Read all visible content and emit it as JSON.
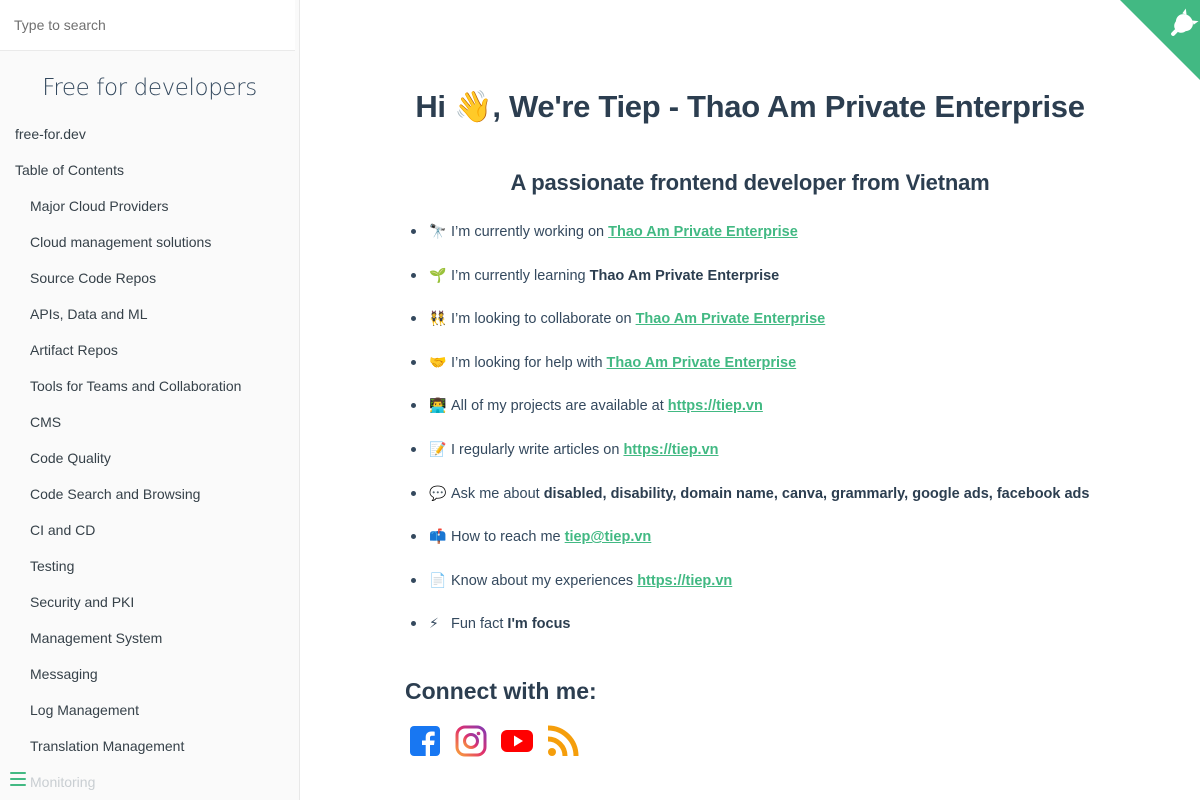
{
  "sidebar": {
    "search_placeholder": "Type to search",
    "app_name": "Free for developers",
    "nav": [
      {
        "label": "free-for.dev",
        "level": "top"
      },
      {
        "label": "Table of Contents",
        "level": "top"
      },
      {
        "label": "Major Cloud Providers",
        "level": "sub"
      },
      {
        "label": "Cloud management solutions",
        "level": "sub"
      },
      {
        "label": "Source Code Repos",
        "level": "sub"
      },
      {
        "label": "APIs, Data and ML",
        "level": "sub"
      },
      {
        "label": "Artifact Repos",
        "level": "sub"
      },
      {
        "label": "Tools for Teams and Collaboration",
        "level": "sub"
      },
      {
        "label": "CMS",
        "level": "sub"
      },
      {
        "label": "Code Quality",
        "level": "sub"
      },
      {
        "label": "Code Search and Browsing",
        "level": "sub"
      },
      {
        "label": "CI and CD",
        "level": "sub"
      },
      {
        "label": "Testing",
        "level": "sub"
      },
      {
        "label": "Security and PKI",
        "level": "sub"
      },
      {
        "label": "Management System",
        "level": "sub"
      },
      {
        "label": "Messaging",
        "level": "sub"
      },
      {
        "label": "Log Management",
        "level": "sub"
      },
      {
        "label": "Translation Management",
        "level": "sub"
      },
      {
        "label": "Monitoring",
        "level": "sub"
      }
    ]
  },
  "main": {
    "hero": {
      "prefix": "Hi ",
      "emoji": "👋",
      "suffix": ", We're Tiep - Thao Am Private Enterprise"
    },
    "tagline": "A passionate frontend developer from Vietnam",
    "facts": [
      {
        "emoji": "🔭",
        "text": "I’m currently working on ",
        "link": "Thao Am Private Enterprise"
      },
      {
        "emoji": "🌱",
        "text": "I’m currently learning ",
        "strong": "Thao Am Private Enterprise"
      },
      {
        "emoji": "👯",
        "text": "I’m looking to collaborate on ",
        "link": "Thao Am Private Enterprise"
      },
      {
        "emoji": "🤝",
        "text": "I’m looking for help with ",
        "link": "Thao Am Private Enterprise"
      },
      {
        "emoji": "👨‍💻",
        "text": "All of my projects are available at ",
        "link": "https://tiep.vn"
      },
      {
        "emoji": "📝",
        "text": "I regularly write articles on ",
        "link": "https://tiep.vn"
      },
      {
        "emoji": "💬",
        "text": "Ask me about ",
        "strong": "disabled, disability, domain name, canva, grammarly, google ads, facebook ads"
      },
      {
        "emoji": "📫",
        "text": "How to reach me ",
        "link": "tiep@tiep.vn"
      },
      {
        "emoji": "📄",
        "text": "Know about my experiences ",
        "link": "https://tiep.vn"
      },
      {
        "emoji": "⚡",
        "text": "Fun fact ",
        "strong": "I'm focus"
      }
    ],
    "connect_heading": "Connect with me:",
    "socials": [
      {
        "icon": "facebook-icon",
        "color": "#1877f2"
      },
      {
        "icon": "instagram-icon",
        "color": "#e1306c"
      },
      {
        "icon": "youtube-icon",
        "color": "#ff0000"
      },
      {
        "icon": "rss-icon",
        "color": "#f59e0b"
      }
    ]
  },
  "colors": {
    "accent": "#42b983",
    "text": "#34495e",
    "heading": "#2c3e50",
    "sidebar_bg": "#fafafa"
  }
}
